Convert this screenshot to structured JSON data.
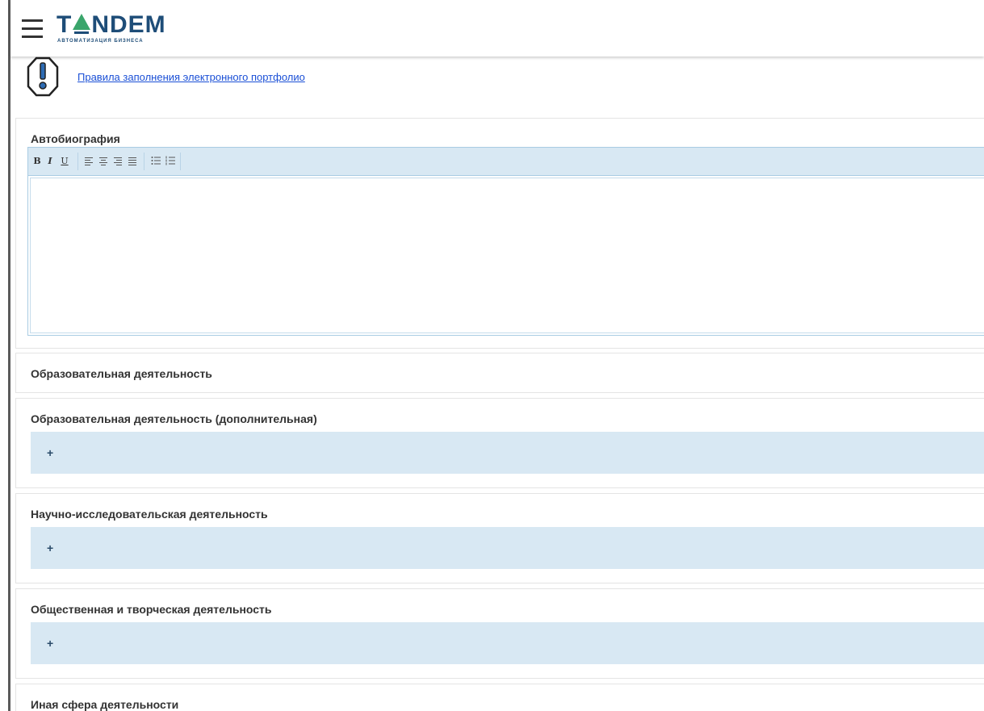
{
  "header": {
    "logo_text": "TANDEM",
    "logo_subtitle": "АВТОМАТИЗАЦИЯ БИЗНЕСА",
    "brand_colors": {
      "primary": "#1e4d78",
      "accent": "#3aa56b"
    }
  },
  "rules": {
    "link_text": "Правила заполнения электронного портфолио",
    "icon": "warning-icon"
  },
  "autobiography": {
    "title": "Автобиография",
    "toolbar": {
      "bold": "B",
      "italic": "I",
      "underline": "U",
      "buttons": [
        "bold",
        "italic",
        "underline",
        "align-left",
        "align-center",
        "align-right",
        "align-justify",
        "bullet-list",
        "numbered-list"
      ]
    },
    "content": ""
  },
  "sections": [
    {
      "title": "Образовательная деятельность"
    },
    {
      "title": "Образовательная деятельность (дополнительная)",
      "add_label": "+"
    },
    {
      "title": "Научно-исследовательская деятельность",
      "add_label": "+"
    },
    {
      "title": "Общественная и творческая деятельность",
      "add_label": "+"
    },
    {
      "title": "Иная сфера деятельности"
    }
  ],
  "colors": {
    "panel": "#d8e8f3",
    "link": "#1a4fd6",
    "text": "#333333"
  }
}
